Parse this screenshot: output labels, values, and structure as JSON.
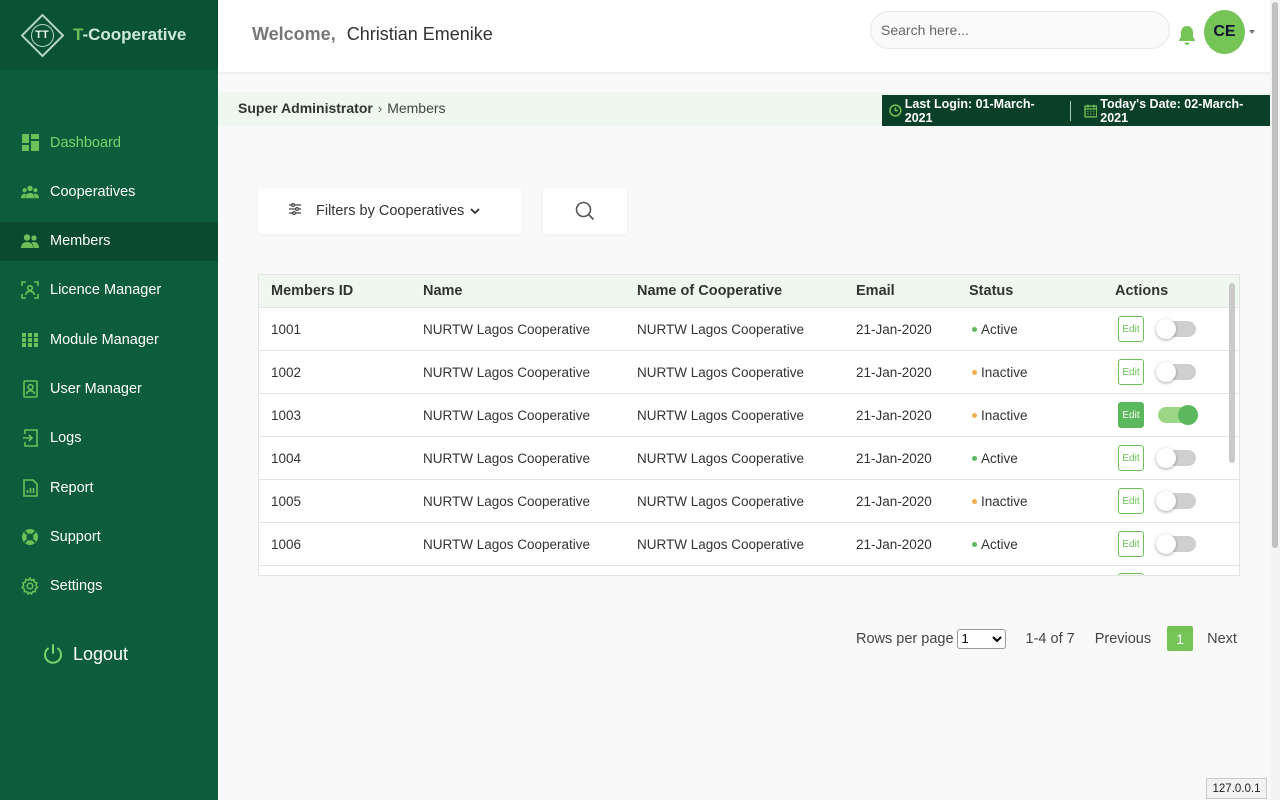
{
  "brand": {
    "logo_letters": "TT",
    "name_prefix": "T",
    "name_rest": "-Cooperative"
  },
  "header": {
    "welcome_label": "Welcome,",
    "user_name": "Christian Emenike",
    "search_placeholder": "Search here...",
    "avatar_initials": "CE"
  },
  "sidebar": {
    "items": [
      {
        "label": "Dashboard",
        "icon": "dashboard-icon"
      },
      {
        "label": "Cooperatives",
        "icon": "group-icon"
      },
      {
        "label": "Members",
        "icon": "members-icon"
      },
      {
        "label": "Licence Manager",
        "icon": "licence-icon"
      },
      {
        "label": "Module Manager",
        "icon": "grid-icon"
      },
      {
        "label": "User Manager",
        "icon": "user-badge-icon"
      },
      {
        "label": "Logs",
        "icon": "login-icon"
      },
      {
        "label": "Report",
        "icon": "report-icon"
      },
      {
        "label": "Support",
        "icon": "lifebuoy-icon"
      },
      {
        "label": "Settings",
        "icon": "gear-icon"
      }
    ],
    "logout_label": "Logout"
  },
  "breadcrumb": {
    "root": "Super Administrator",
    "separator": "›",
    "current": "Members"
  },
  "datebar": {
    "last_login": "Last Login: 01-March-2021",
    "today": "Today's Date: 02-March-2021"
  },
  "filters": {
    "label": "Filters by Cooperatives"
  },
  "table": {
    "columns": [
      "Members ID",
      "Name",
      "Name of Cooperative",
      "Email",
      "Status",
      "Actions"
    ],
    "edit_label": "Edit",
    "rows": [
      {
        "id": "1001",
        "name": "NURTW Lagos Cooperative",
        "coop": "NURTW Lagos Cooperative",
        "email": "21-Jan-2020",
        "status": "Active",
        "enabled": false
      },
      {
        "id": "1002",
        "name": "NURTW Lagos Cooperative",
        "coop": "NURTW Lagos Cooperative",
        "email": "21-Jan-2020",
        "status": "Inactive",
        "enabled": false
      },
      {
        "id": "1003",
        "name": "NURTW Lagos Cooperative",
        "coop": "NURTW Lagos Cooperative",
        "email": "21-Jan-2020",
        "status": "Inactive",
        "enabled": true
      },
      {
        "id": "1004",
        "name": "NURTW Lagos Cooperative",
        "coop": "NURTW Lagos Cooperative",
        "email": "21-Jan-2020",
        "status": "Active",
        "enabled": false
      },
      {
        "id": "1005",
        "name": "NURTW Lagos Cooperative",
        "coop": "NURTW Lagos Cooperative",
        "email": "21-Jan-2020",
        "status": "Inactive",
        "enabled": false
      },
      {
        "id": "1006",
        "name": "NURTW Lagos Cooperative",
        "coop": "NURTW Lagos Cooperative",
        "email": "21-Jan-2020",
        "status": "Active",
        "enabled": false
      }
    ]
  },
  "pagination": {
    "rows_per_page_label": "Rows per page",
    "rows_per_page_value": "1",
    "range": "1-4 of 7",
    "previous": "Previous",
    "current_page": "1",
    "next": "Next"
  },
  "status_tip": "127.0.0.1",
  "colors": {
    "sidebar_bg": "#0d5d3c",
    "accent": "#74c556",
    "active_dot": "#5cb85c",
    "inactive_dot": "#f0ad4e",
    "datebar_bg": "#0a3f28"
  }
}
